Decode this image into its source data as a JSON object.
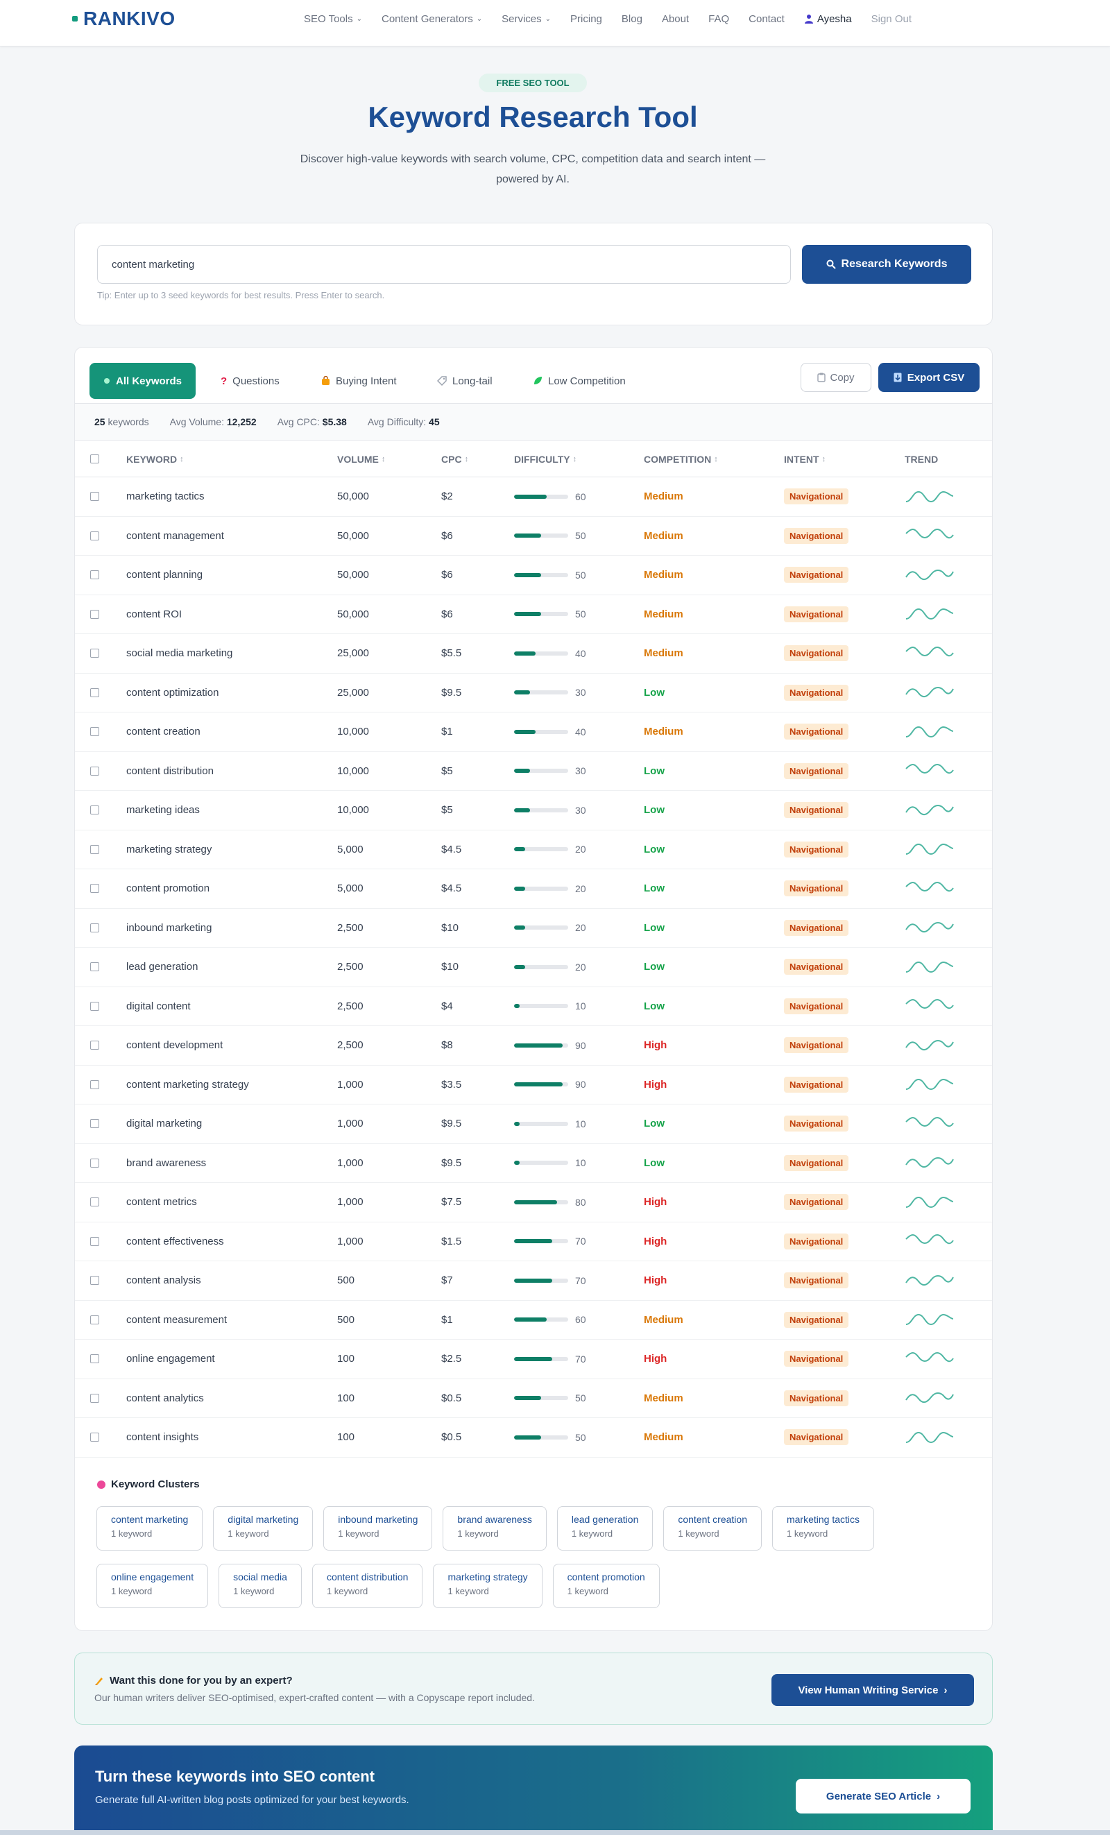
{
  "brand": {
    "name": "RANKIVO"
  },
  "nav": {
    "items": [
      {
        "label": "SEO Tools",
        "dropdown": true
      },
      {
        "label": "Content Generators",
        "dropdown": true
      },
      {
        "label": "Services",
        "dropdown": true
      },
      {
        "label": "Pricing",
        "dropdown": false
      },
      {
        "label": "Blog",
        "dropdown": false
      },
      {
        "label": "About",
        "dropdown": false
      },
      {
        "label": "FAQ",
        "dropdown": false
      },
      {
        "label": "Contact",
        "dropdown": false
      }
    ],
    "user_name": "Ayesha",
    "sign_out": "Sign Out"
  },
  "hero": {
    "badge": "FREE SEO TOOL",
    "title": "Keyword Research Tool",
    "subtitle": "Discover high-value keywords with search volume, CPC, competition data and search intent — powered by AI."
  },
  "search": {
    "value": "content marketing",
    "button": "Research Keywords",
    "tip": "Tip: Enter up to 3 seed keywords for best results. Press Enter to search."
  },
  "tabs": [
    {
      "label": "All Keywords",
      "icon": "star-icon",
      "active": true
    },
    {
      "label": "Questions",
      "icon": "question-icon",
      "active": false
    },
    {
      "label": "Buying Intent",
      "icon": "bag-icon",
      "active": false
    },
    {
      "label": "Long-tail",
      "icon": "tag-icon",
      "active": false
    },
    {
      "label": "Low Competition",
      "icon": "leaf-icon",
      "active": false
    }
  ],
  "actions": {
    "copy": "Copy",
    "export": "Export CSV"
  },
  "stats": {
    "count": "25",
    "count_label": "keywords",
    "avg_volume_label": "Avg Volume:",
    "avg_volume": "12,252",
    "avg_cpc_label": "Avg CPC:",
    "avg_cpc": "$5.38",
    "avg_difficulty_label": "Avg Difficulty:",
    "avg_difficulty": "45"
  },
  "table": {
    "headers": {
      "keyword": "KEYWORD",
      "volume": "VOLUME",
      "cpc": "CPC",
      "difficulty": "DIFFICULTY",
      "competition": "COMPETITION",
      "intent": "INTENT",
      "trend": "TREND"
    },
    "rows": [
      {
        "keyword": "marketing tactics",
        "volume": "50,000",
        "cpc": "$2",
        "difficulty": 60,
        "competition": "Medium",
        "intent": "Navigational"
      },
      {
        "keyword": "content management",
        "volume": "50,000",
        "cpc": "$6",
        "difficulty": 50,
        "competition": "Medium",
        "intent": "Navigational"
      },
      {
        "keyword": "content planning",
        "volume": "50,000",
        "cpc": "$6",
        "difficulty": 50,
        "competition": "Medium",
        "intent": "Navigational"
      },
      {
        "keyword": "content ROI",
        "volume": "50,000",
        "cpc": "$6",
        "difficulty": 50,
        "competition": "Medium",
        "intent": "Navigational"
      },
      {
        "keyword": "social media marketing",
        "volume": "25,000",
        "cpc": "$5.5",
        "difficulty": 40,
        "competition": "Medium",
        "intent": "Navigational"
      },
      {
        "keyword": "content optimization",
        "volume": "25,000",
        "cpc": "$9.5",
        "difficulty": 30,
        "competition": "Low",
        "intent": "Navigational"
      },
      {
        "keyword": "content creation",
        "volume": "10,000",
        "cpc": "$1",
        "difficulty": 40,
        "competition": "Medium",
        "intent": "Navigational"
      },
      {
        "keyword": "content distribution",
        "volume": "10,000",
        "cpc": "$5",
        "difficulty": 30,
        "competition": "Low",
        "intent": "Navigational"
      },
      {
        "keyword": "marketing ideas",
        "volume": "10,000",
        "cpc": "$5",
        "difficulty": 30,
        "competition": "Low",
        "intent": "Navigational"
      },
      {
        "keyword": "marketing strategy",
        "volume": "5,000",
        "cpc": "$4.5",
        "difficulty": 20,
        "competition": "Low",
        "intent": "Navigational"
      },
      {
        "keyword": "content promotion",
        "volume": "5,000",
        "cpc": "$4.5",
        "difficulty": 20,
        "competition": "Low",
        "intent": "Navigational"
      },
      {
        "keyword": "inbound marketing",
        "volume": "2,500",
        "cpc": "$10",
        "difficulty": 20,
        "competition": "Low",
        "intent": "Navigational"
      },
      {
        "keyword": "lead generation",
        "volume": "2,500",
        "cpc": "$10",
        "difficulty": 20,
        "competition": "Low",
        "intent": "Navigational"
      },
      {
        "keyword": "digital content",
        "volume": "2,500",
        "cpc": "$4",
        "difficulty": 10,
        "competition": "Low",
        "intent": "Navigational"
      },
      {
        "keyword": "content development",
        "volume": "2,500",
        "cpc": "$8",
        "difficulty": 90,
        "competition": "High",
        "intent": "Navigational"
      },
      {
        "keyword": "content marketing strategy",
        "volume": "1,000",
        "cpc": "$3.5",
        "difficulty": 90,
        "competition": "High",
        "intent": "Navigational"
      },
      {
        "keyword": "digital marketing",
        "volume": "1,000",
        "cpc": "$9.5",
        "difficulty": 10,
        "competition": "Low",
        "intent": "Navigational"
      },
      {
        "keyword": "brand awareness",
        "volume": "1,000",
        "cpc": "$9.5",
        "difficulty": 10,
        "competition": "Low",
        "intent": "Navigational"
      },
      {
        "keyword": "content metrics",
        "volume": "1,000",
        "cpc": "$7.5",
        "difficulty": 80,
        "competition": "High",
        "intent": "Navigational"
      },
      {
        "keyword": "content effectiveness",
        "volume": "1,000",
        "cpc": "$1.5",
        "difficulty": 70,
        "competition": "High",
        "intent": "Navigational"
      },
      {
        "keyword": "content analysis",
        "volume": "500",
        "cpc": "$7",
        "difficulty": 70,
        "competition": "High",
        "intent": "Navigational"
      },
      {
        "keyword": "content measurement",
        "volume": "500",
        "cpc": "$1",
        "difficulty": 60,
        "competition": "Medium",
        "intent": "Navigational"
      },
      {
        "keyword": "online engagement",
        "volume": "100",
        "cpc": "$2.5",
        "difficulty": 70,
        "competition": "High",
        "intent": "Navigational"
      },
      {
        "keyword": "content analytics",
        "volume": "100",
        "cpc": "$0.5",
        "difficulty": 50,
        "competition": "Medium",
        "intent": "Navigational"
      },
      {
        "keyword": "content insights",
        "volume": "100",
        "cpc": "$0.5",
        "difficulty": 50,
        "competition": "Medium",
        "intent": "Navigational"
      }
    ]
  },
  "clusters": {
    "title": "Keyword Clusters",
    "items": [
      {
        "name": "content marketing",
        "count": "1 keyword"
      },
      {
        "name": "digital marketing",
        "count": "1 keyword"
      },
      {
        "name": "inbound marketing",
        "count": "1 keyword"
      },
      {
        "name": "brand awareness",
        "count": "1 keyword"
      },
      {
        "name": "lead generation",
        "count": "1 keyword"
      },
      {
        "name": "content creation",
        "count": "1 keyword"
      },
      {
        "name": "marketing tactics",
        "count": "1 keyword"
      },
      {
        "name": "online engagement",
        "count": "1 keyword"
      },
      {
        "name": "social media",
        "count": "1 keyword"
      },
      {
        "name": "content distribution",
        "count": "1 keyword"
      },
      {
        "name": "marketing strategy",
        "count": "1 keyword"
      },
      {
        "name": "content promotion",
        "count": "1 keyword"
      }
    ]
  },
  "expert": {
    "title": "Want this done for you by an expert?",
    "desc": "Our human writers deliver SEO-optimised, expert-crafted content — with a Copyscape report included.",
    "button": "View Human Writing Service"
  },
  "cta": {
    "title": "Turn these keywords into SEO content",
    "sub": "Generate full AI-written blog posts optimized for your best keywords.",
    "button": "Generate SEO Article"
  },
  "colors": {
    "brand_blue": "#1d4f95",
    "accent_green": "#159479",
    "bar_green": "#0e7f66",
    "low": "#16a34a",
    "medium": "#d97706",
    "high": "#dc2626",
    "intent_bg": "#fdebd3",
    "intent_text": "#c2410c"
  }
}
